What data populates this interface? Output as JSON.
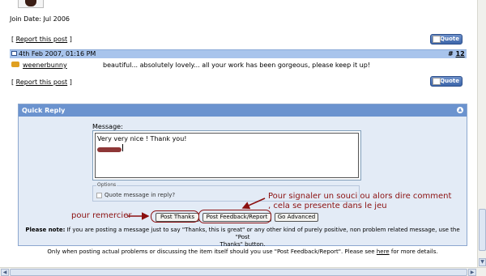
{
  "prev_post": {
    "join_date": "Join Date: Jul 2006",
    "report_open": "[ ",
    "report_link": "Report this post",
    "report_close": " ]",
    "quote_label": "Quote"
  },
  "post": {
    "datetime": "4th Feb 2007, 01:16 PM",
    "number_prefix": "# ",
    "number": "12",
    "username": "weenerbunny",
    "message": "beautiful... absolutely lovely... all your work has been gorgeous, please keep it up!",
    "report_open": "[ ",
    "report_link": "Report this post",
    "report_close": " ]",
    "quote_label": "Quote"
  },
  "quick_reply": {
    "title": "Quick Reply",
    "message_label": "Message:",
    "message_text": "Very very nice ! Thank you!",
    "options_legend": "Options",
    "quote_checkbox_label": "Quote message in reply?",
    "buttons": {
      "post_thanks": "Post Thanks",
      "post_feedback": "Post Feedback/Report",
      "go_advanced": "Go Advanced"
    },
    "note_label": "Please note:",
    "note_line1": " If you are posting a message just to say \"Thanks, this is great\" or any other kind of purely positive, non problem related message, use the \"Post",
    "note_line2": "Thanks\" button.",
    "note_line3_pre": "Only when posting actual problems or discussing the item itself should you use \"Post Feedback/Report\". Please see ",
    "note_link": "here",
    "note_line3_post": " for more details."
  },
  "annotations": {
    "left": "pour remercier",
    "right_line1": "Pour signaler un souci ou alors dire comment",
    "right_line2": ", cela se presente dans le jeu"
  },
  "colors": {
    "post_bar": "#a8c4ec",
    "quick_reply_header": "#6b93cf",
    "annotation": "#8b1010"
  }
}
